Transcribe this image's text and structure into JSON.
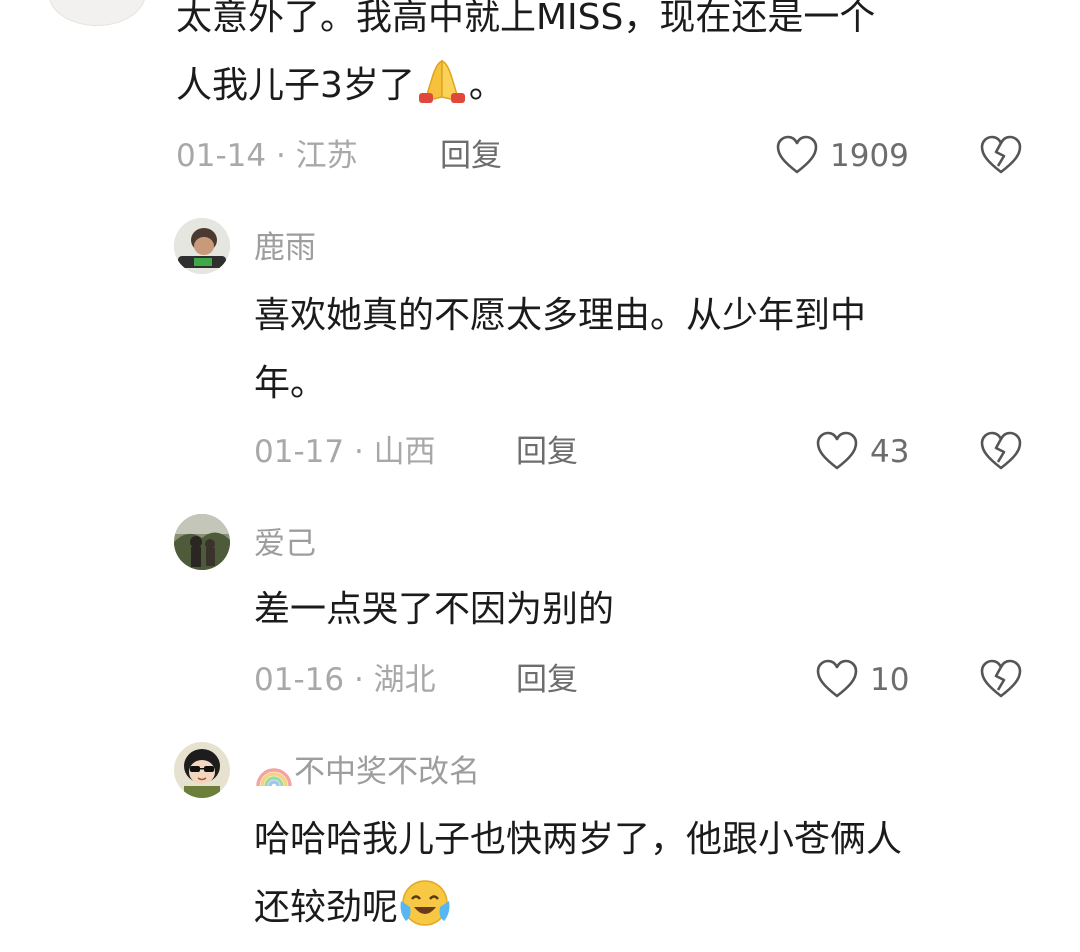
{
  "comments": [
    {
      "lines": [
        "太意外了。我高中就上MISS，现在还是一个",
        "人我儿子3岁了",
        "。"
      ],
      "date": "01-14",
      "separator": "·",
      "location": "江苏",
      "reply_label": "回复",
      "likes": "1909"
    }
  ],
  "replies": [
    {
      "username": "鹿雨",
      "lines": [
        "喜欢她真的不愿太多理由。从少年到中",
        "年。"
      ],
      "date": "01-17",
      "separator": "·",
      "location": "山西",
      "reply_label": "回复",
      "likes": "43"
    },
    {
      "username": "爱己",
      "lines": [
        "差一点哭了不因为别的"
      ],
      "date": "01-16",
      "separator": "·",
      "location": "湖北",
      "reply_label": "回复",
      "likes": "10"
    },
    {
      "username": "不中奖不改名",
      "lines": [
        "哈哈哈我儿子也快两岁了，他跟小苍俩人",
        "还较劲呢"
      ]
    }
  ],
  "icons": {
    "like": "heart-outline-icon",
    "dislike": "broken-heart-icon",
    "pray": "folded-hands-emoji",
    "cry_laugh": "crying-emoji",
    "rainbow": "rainbow-emoji"
  },
  "colors": {
    "text": "#1b1b1b",
    "meta": "#a8a8a8",
    "action": "#6d6d6d",
    "icon_stroke": "#555555"
  }
}
